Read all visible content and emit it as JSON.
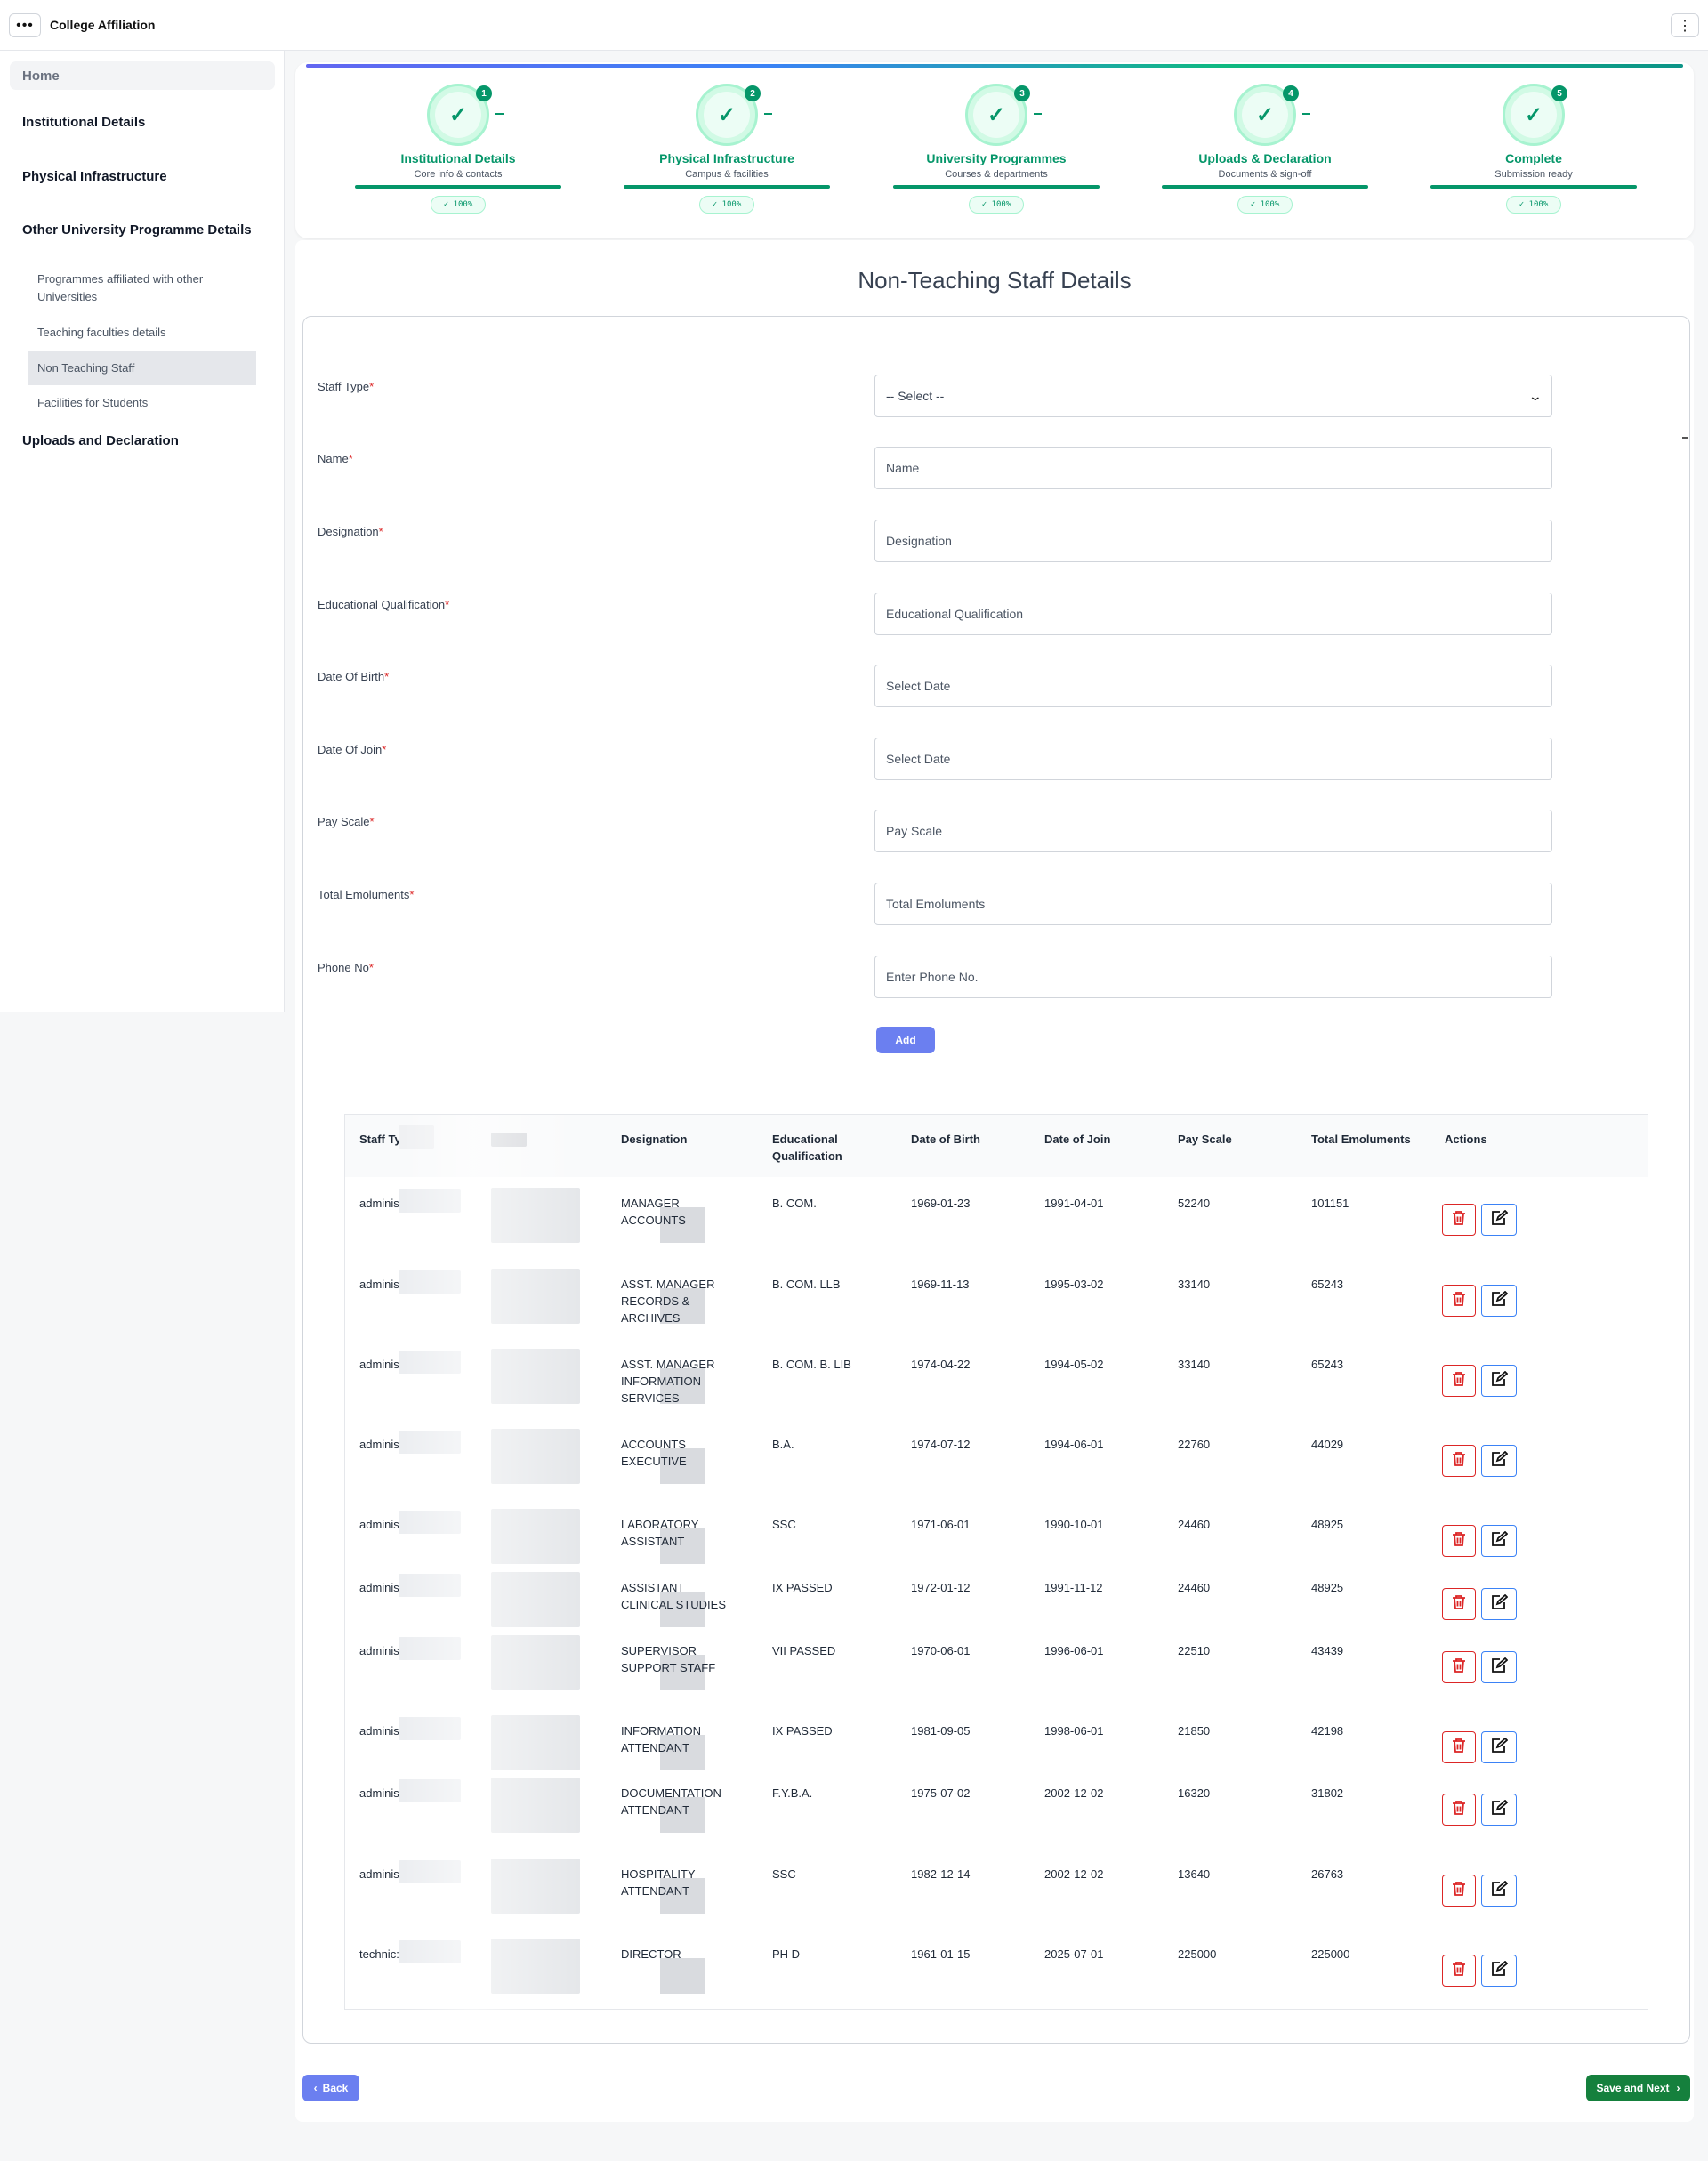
{
  "app": {
    "title": "College Affiliation"
  },
  "sidebar": {
    "home": "Home",
    "sections": [
      {
        "label": "Institutional Details"
      },
      {
        "label": "Physical Infrastructure"
      },
      {
        "label": "Other University Programme Details"
      }
    ],
    "sub_items": [
      {
        "label": "Programmes affiliated with other Universities"
      },
      {
        "label": "Teaching faculties details"
      },
      {
        "label": "Non Teaching Staff"
      },
      {
        "label": "Facilities for Students"
      }
    ],
    "last_section": "Uploads and Declaration"
  },
  "stepper": {
    "steps": [
      {
        "num": "1",
        "title": "Institutional Details",
        "sub": "Core info & contacts",
        "badge": "✓ 100%"
      },
      {
        "num": "2",
        "title": "Physical Infrastructure",
        "sub": "Campus & facilities",
        "badge": "✓ 100%"
      },
      {
        "num": "3",
        "title": "University Programmes",
        "sub": "Courses & departments",
        "badge": "✓ 100%"
      },
      {
        "num": "4",
        "title": "Uploads & Declaration",
        "sub": "Documents & sign-off",
        "badge": "✓ 100%"
      },
      {
        "num": "5",
        "title": "Complete",
        "sub": "Submission ready",
        "badge": "✓ 100%"
      }
    ],
    "colors": {
      "complete": "#059669"
    }
  },
  "page_title": "Non-Teaching Staff Details",
  "form": {
    "staff_type": {
      "label": "Staff Type",
      "value": "-- Select --"
    },
    "fields": [
      {
        "label": "Name",
        "placeholder": "Name"
      },
      {
        "label": "Designation",
        "placeholder": "Designation"
      },
      {
        "label": "Educational Qualification",
        "placeholder": "Educational Qualification"
      },
      {
        "label": "Date Of Birth",
        "placeholder": "Select Date"
      },
      {
        "label": "Date Of Join",
        "placeholder": "Select Date"
      },
      {
        "label": "Pay Scale",
        "placeholder": "Pay Scale"
      },
      {
        "label": "Total Emoluments",
        "placeholder": "Total Emoluments"
      },
      {
        "label": "Phone No",
        "placeholder": "Enter Phone No."
      }
    ],
    "required_mark": "*",
    "add_label": "Add"
  },
  "table": {
    "headers": {
      "staff_type": "Staff Ty",
      "designation": "Designation",
      "qualification": "Educational Qualification",
      "dob": "Date of Birth",
      "doj": "Date of Join",
      "pay_scale": "Pay Scale",
      "total": "Total Emoluments",
      "actions": "Actions"
    },
    "rows": [
      {
        "staff_type": "adminis",
        "designation": "MANAGER ACCOUNTS",
        "qualification": "B. COM.",
        "dob": "1969-01-23",
        "doj": "1991-04-01",
        "pay": "52240",
        "total": "101151"
      },
      {
        "staff_type": "adminis",
        "designation": "ASST. MANAGER RECORDS & ARCHIVES",
        "qualification": "B. COM. LLB",
        "dob": "1969-11-13",
        "doj": "1995-03-02",
        "pay": "33140",
        "total": "65243"
      },
      {
        "staff_type": "adminis",
        "designation": "ASST. MANAGER INFORMATION SERVICES",
        "qualification": "B. COM. B. LIB",
        "dob": "1974-04-22",
        "doj": "1994-05-02",
        "pay": "33140",
        "total": "65243"
      },
      {
        "staff_type": "adminis",
        "designation": "ACCOUNTS EXECUTIVE",
        "qualification": "B.A.",
        "dob": "1974-07-12",
        "doj": "1994-06-01",
        "pay": "22760",
        "total": "44029"
      },
      {
        "staff_type": "adminis",
        "designation": "LABORATORY ASSISTANT",
        "qualification": "SSC",
        "dob": "1971-06-01",
        "doj": "1990-10-01",
        "pay": "24460",
        "total": "48925"
      },
      {
        "staff_type": "adminis",
        "designation": "ASSISTANT CLINICAL STUDIES",
        "qualification": "IX PASSED",
        "dob": "1972-01-12",
        "doj": "1991-11-12",
        "pay": "24460",
        "total": "48925"
      },
      {
        "staff_type": "adminis",
        "designation": "SUPERVISOR SUPPORT STAFF",
        "qualification": "VII PASSED",
        "dob": "1970-06-01",
        "doj": "1996-06-01",
        "pay": "22510",
        "total": "43439"
      },
      {
        "staff_type": "adminis",
        "designation": "INFORMATION ATTENDANT",
        "qualification": "IX PASSED",
        "dob": "1981-09-05",
        "doj": "1998-06-01",
        "pay": "21850",
        "total": "42198"
      },
      {
        "staff_type": "adminis",
        "designation": "DOCUMENTATION ATTENDANT",
        "qualification": "F.Y.B.A.",
        "dob": "1975-07-02",
        "doj": "2002-12-02",
        "pay": "16320",
        "total": "31802"
      },
      {
        "staff_type": "adminis",
        "designation": "HOSPITALITY ATTENDANT",
        "qualification": "SSC",
        "dob": "1982-12-14",
        "doj": "2002-12-02",
        "pay": "13640",
        "total": "26763"
      },
      {
        "staff_type": "technic:",
        "designation": "DIRECTOR",
        "qualification": "PH D",
        "dob": "1961-01-15",
        "doj": "2025-07-01",
        "pay": "225000",
        "total": "225000"
      }
    ]
  },
  "footer": {
    "back_label": "Back",
    "next_label": "Save and Next"
  }
}
